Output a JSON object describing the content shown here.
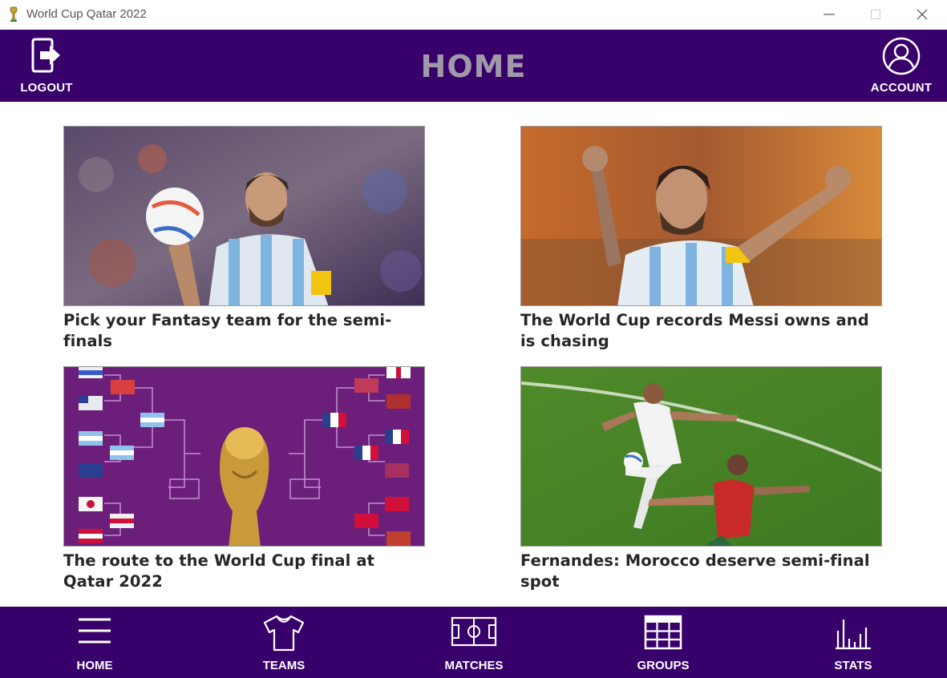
{
  "window": {
    "title": "World Cup Qatar 2022",
    "icon": "trophy-icon"
  },
  "header": {
    "title": "HOME",
    "logout_label": "LOGOUT",
    "logout_icon": "logout-icon",
    "account_label": "ACCOUNT",
    "account_icon": "account-icon",
    "background": "#38006b"
  },
  "news": [
    {
      "headline": "Pick your Fantasy team for the semi-finals",
      "image": "player-with-ball-photo"
    },
    {
      "headline": "The World Cup records Messi owns and is chasing",
      "image": "player-celebrating-photo"
    },
    {
      "headline": "The route to the World Cup final at Qatar 2022",
      "image": "tournament-bracket-trophy-graphic"
    },
    {
      "headline": "Fernandes: Morocco deserve semi-final spot",
      "image": "match-action-photo"
    }
  ],
  "bottom_nav": [
    {
      "label": "HOME",
      "icon": "menu-icon"
    },
    {
      "label": "TEAMS",
      "icon": "shirt-icon"
    },
    {
      "label": "MATCHES",
      "icon": "pitch-icon"
    },
    {
      "label": "GROUPS",
      "icon": "grid-icon"
    },
    {
      "label": "STATS",
      "icon": "bar-chart-icon"
    }
  ]
}
